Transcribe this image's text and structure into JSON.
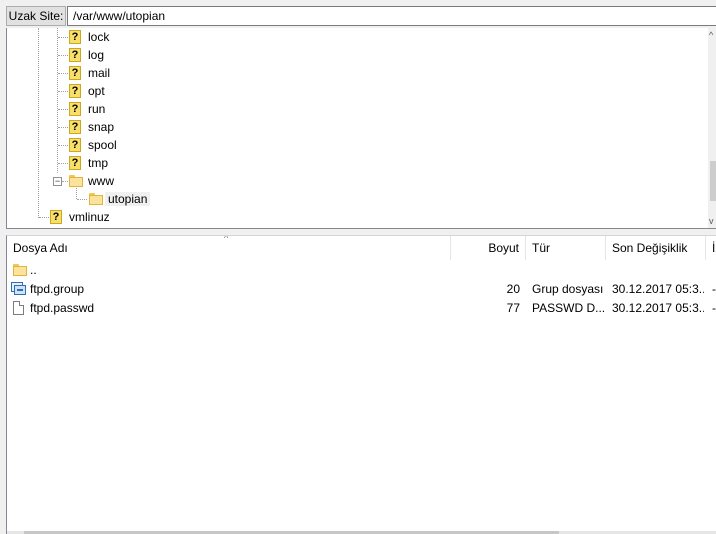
{
  "remote_site": {
    "label": "Uzak Site:",
    "path": "/var/www/utopian"
  },
  "tree": {
    "items": [
      {
        "label": "lock",
        "icon": "unknown-folder-icon"
      },
      {
        "label": "log",
        "icon": "unknown-folder-icon"
      },
      {
        "label": "mail",
        "icon": "unknown-folder-icon"
      },
      {
        "label": "opt",
        "icon": "unknown-folder-icon"
      },
      {
        "label": "run",
        "icon": "unknown-folder-icon"
      },
      {
        "label": "snap",
        "icon": "unknown-folder-icon"
      },
      {
        "label": "spool",
        "icon": "unknown-folder-icon"
      },
      {
        "label": "tmp",
        "icon": "unknown-folder-icon"
      },
      {
        "label": "www",
        "icon": "folder-icon",
        "expander": "−"
      },
      {
        "label": "utopian",
        "icon": "folder-icon"
      },
      {
        "label": "vmlinuz",
        "icon": "unknown-folder-icon"
      }
    ]
  },
  "file_list": {
    "columns": {
      "name": "Dosya Adı",
      "size": "Boyut",
      "type": "Tür",
      "modified": "Son Değişiklik",
      "perm": "İz"
    },
    "sort_indicator": "^",
    "rows": [
      {
        "name": "..",
        "size": "",
        "type": "",
        "modified": "",
        "perm": "",
        "icon": "folder-icon"
      },
      {
        "name": "ftpd.group",
        "size": "20",
        "type": "Grup dosyası",
        "modified": "30.12.2017 05:3...",
        "perm": "-",
        "icon": "group-file-icon"
      },
      {
        "name": "ftpd.passwd",
        "size": "77",
        "type": "PASSWD D...",
        "modified": "30.12.2017 05:3...",
        "perm": "-",
        "icon": "file-icon"
      }
    ]
  },
  "scroll": {
    "up": "^",
    "down": "v"
  }
}
